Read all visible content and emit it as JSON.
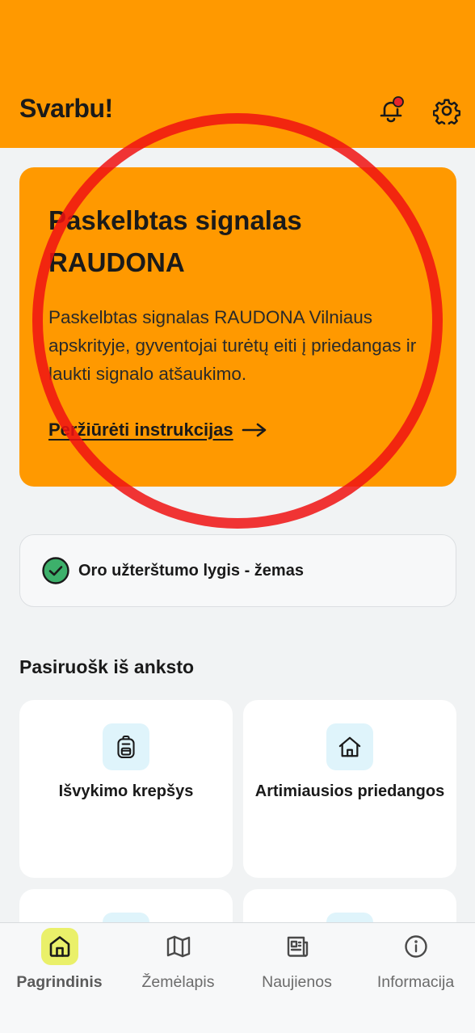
{
  "header": {
    "title": "Svarbu!",
    "notification_icon": "bell-with-badge-icon",
    "settings_icon": "gear-icon",
    "badge_color": "#e8242b"
  },
  "alert": {
    "title": "Paskelbtas signalas RAUDONA",
    "body": "Paskelbtas signalas RAUDONA Vilniaus apskrityje, gyventojai turėtų eiti į priedangas ir laukti signalo atšaukimo.",
    "link_label": "Peržiūrėti instrukcijas",
    "background_color": "#ff9900"
  },
  "air_quality": {
    "icon": "check-circle-icon",
    "text": "Oro užterštumo lygis - žemas",
    "status_color": "#3db06b"
  },
  "prepare": {
    "title": "Pasiruošk iš anksto",
    "tiles": [
      {
        "label": "Išvykimo krepšys",
        "icon": "backpack-icon"
      },
      {
        "label": "Artimiausios priedangos",
        "icon": "house-icon"
      }
    ]
  },
  "bottom_nav": {
    "items": [
      {
        "label": "Pagrindinis",
        "icon": "home-icon",
        "active": true
      },
      {
        "label": "Žemėlapis",
        "icon": "map-icon",
        "active": false
      },
      {
        "label": "Naujienos",
        "icon": "newspaper-icon",
        "active": false
      },
      {
        "label": "Informacija",
        "icon": "info-icon",
        "active": false
      }
    ],
    "active_color": "#eaf06a"
  }
}
